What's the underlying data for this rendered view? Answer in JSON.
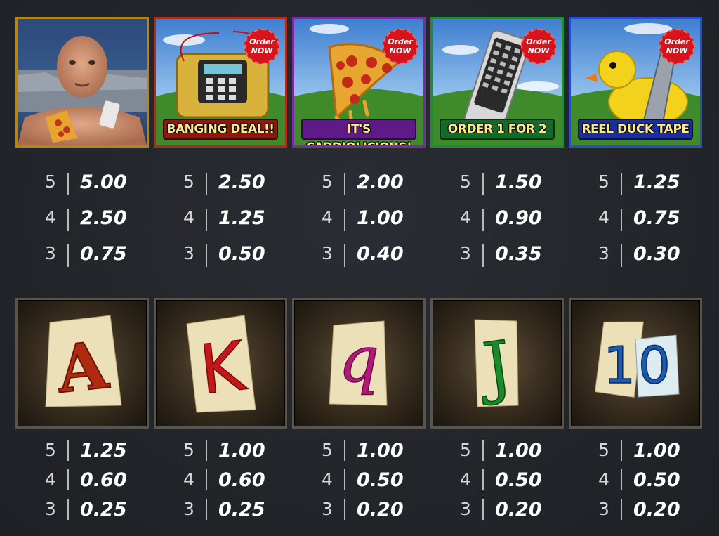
{
  "high_symbols": [
    {
      "name": "Man",
      "banner": "",
      "tag": "",
      "border": "#b8860b",
      "payouts": [
        {
          "count": "5",
          "value": "5.00"
        },
        {
          "count": "4",
          "value": "2.50"
        },
        {
          "count": "3",
          "value": "0.75"
        }
      ]
    },
    {
      "name": "Bomb",
      "banner": "BANGING DEAL!!",
      "tag": "Order NOW",
      "border": "#b22a1a",
      "banner_bg": "#8a1a10",
      "payouts": [
        {
          "count": "5",
          "value": "2.50"
        },
        {
          "count": "4",
          "value": "1.25"
        },
        {
          "count": "3",
          "value": "0.50"
        }
      ]
    },
    {
      "name": "Pizza",
      "banner": "IT'S CARDIOLICIOUS!",
      "tag": "Order NOW",
      "border": "#7a2aa8",
      "banner_bg": "#5e1a86",
      "payouts": [
        {
          "count": "5",
          "value": "2.00"
        },
        {
          "count": "4",
          "value": "1.00"
        },
        {
          "count": "3",
          "value": "0.40"
        }
      ]
    },
    {
      "name": "Remote",
      "banner": "ORDER 1 FOR 2",
      "tag": "Order NOW",
      "border": "#1e8a3a",
      "banner_bg": "#146a28",
      "payouts": [
        {
          "count": "5",
          "value": "1.50"
        },
        {
          "count": "4",
          "value": "0.90"
        },
        {
          "count": "3",
          "value": "0.35"
        }
      ]
    },
    {
      "name": "Duck",
      "banner": "REEL DUCK TAPE",
      "tag": "Order NOW",
      "border": "#2a4ad8",
      "banner_bg": "#1a2f9a",
      "payouts": [
        {
          "count": "5",
          "value": "1.25"
        },
        {
          "count": "4",
          "value": "0.75"
        },
        {
          "count": "3",
          "value": "0.30"
        }
      ]
    }
  ],
  "low_symbols": [
    {
      "letter": "A",
      "color": "#b02a10",
      "payouts": [
        {
          "count": "5",
          "value": "1.25"
        },
        {
          "count": "4",
          "value": "0.60"
        },
        {
          "count": "3",
          "value": "0.25"
        }
      ]
    },
    {
      "letter": "K",
      "color": "#c41818",
      "payouts": [
        {
          "count": "5",
          "value": "1.00"
        },
        {
          "count": "4",
          "value": "0.60"
        },
        {
          "count": "3",
          "value": "0.25"
        }
      ]
    },
    {
      "letter": "q",
      "color": "#b01a78",
      "payouts": [
        {
          "count": "5",
          "value": "1.00"
        },
        {
          "count": "4",
          "value": "0.50"
        },
        {
          "count": "3",
          "value": "0.20"
        }
      ]
    },
    {
      "letter": "J",
      "color": "#1a8a2a",
      "payouts": [
        {
          "count": "5",
          "value": "1.00"
        },
        {
          "count": "4",
          "value": "0.50"
        },
        {
          "count": "3",
          "value": "0.20"
        }
      ]
    },
    {
      "letter": "10",
      "color": "#1a5ab0",
      "payouts": [
        {
          "count": "5",
          "value": "1.00"
        },
        {
          "count": "4",
          "value": "0.50"
        },
        {
          "count": "3",
          "value": "0.20"
        }
      ]
    }
  ]
}
